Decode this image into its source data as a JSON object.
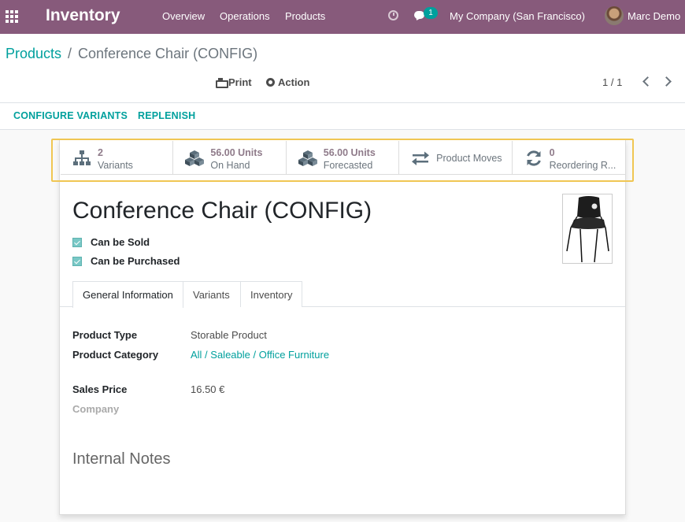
{
  "navbar": {
    "app_title": "Inventory",
    "menu": [
      "Overview",
      "Operations",
      "Products"
    ],
    "chat_count": "1",
    "company": "My Company (San Francisco)",
    "user": "Marc Demo",
    "bg_color": "#875a7b"
  },
  "breadcrumb": {
    "root": "Products",
    "separator": "/",
    "current": "Conference Chair (CONFIG)"
  },
  "actions": {
    "print": "Print",
    "action": "Action"
  },
  "pager": {
    "value": "1 / 1"
  },
  "statusbar": {
    "configure_variants": "CONFIGURE VARIANTS",
    "replenish": "REPLENISH"
  },
  "smart_buttons": [
    {
      "icon": "sitemap-icon",
      "value": "2",
      "label": "Variants"
    },
    {
      "icon": "cubes-icon",
      "value": "56.00 Units",
      "label": "On Hand"
    },
    {
      "icon": "cubes-icon",
      "value": "56.00 Units",
      "label": "Forecasted"
    },
    {
      "icon": "exchange-icon",
      "value": "",
      "label": "Product Moves"
    },
    {
      "icon": "refresh-icon",
      "value": "0",
      "label": "Reordering R..."
    }
  ],
  "product": {
    "name": "Conference Chair (CONFIG)",
    "can_be_sold_label": "Can be Sold",
    "can_be_sold": true,
    "can_be_purchased_label": "Can be Purchased",
    "can_be_purchased": true
  },
  "tabs": [
    "General Information",
    "Variants",
    "Inventory"
  ],
  "fields": {
    "product_type_label": "Product Type",
    "product_type": "Storable Product",
    "product_category_label": "Product Category",
    "product_category": "All / Saleable / Office Furniture",
    "sales_price_label": "Sales Price",
    "sales_price": "16.50 €",
    "company_label": "Company"
  },
  "internal_notes_title": "Internal Notes",
  "colors": {
    "accent": "#00a09d",
    "highlight_frame": "#f0c653"
  }
}
